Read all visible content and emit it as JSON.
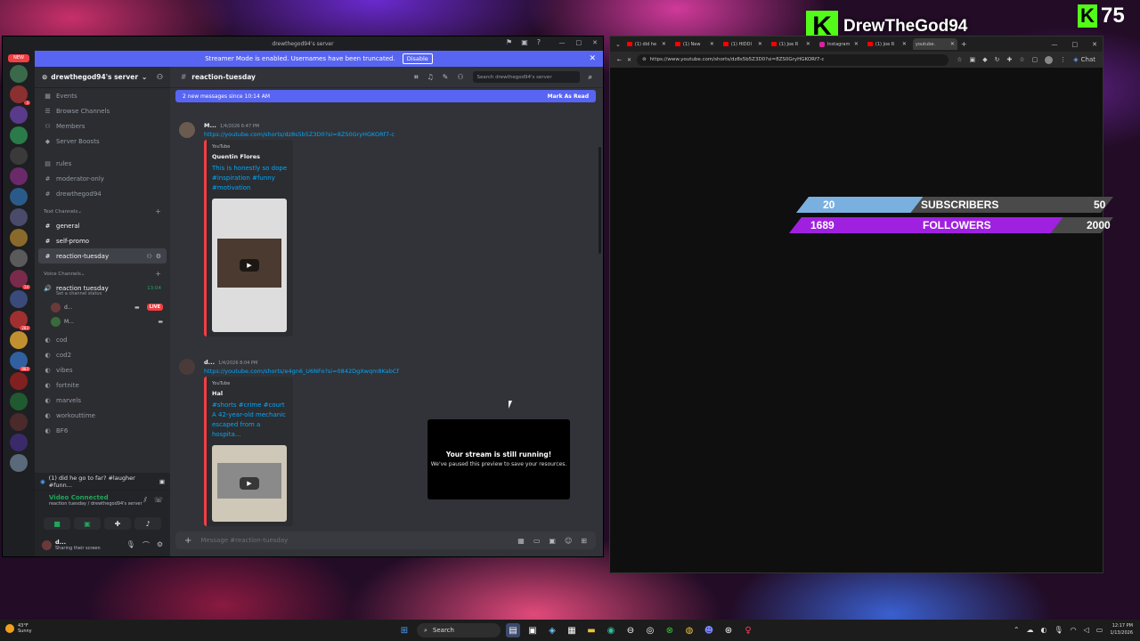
{
  "discord": {
    "window_title": "drewthegod94's server",
    "banner": {
      "text": "Streamer Mode is enabled. Usernames have been truncated.",
      "button": "Disable"
    },
    "new_badge": "NEW",
    "server_name": "drewthegod94's server",
    "top_items": [
      "Events",
      "Browse Channels",
      "Members",
      "Server Boosts"
    ],
    "info_channels": [
      "rules",
      "moderator-only",
      "drewthegod94"
    ],
    "text_category": "Text Channels",
    "text_channels": [
      "general",
      "self-promo",
      "reaction-tuesday"
    ],
    "voice_category": "Voice Channels",
    "voice_channel": {
      "name": "reaction tuesday",
      "time": "13:04",
      "status": "Set a channel status"
    },
    "voice_users": [
      {
        "name": "d...",
        "badge": "LIVE"
      },
      {
        "name": "M..."
      }
    ],
    "voice_channels_more": [
      "cod",
      "cod2",
      "vibes",
      "fortnite",
      "marvels",
      "workouttime",
      "BF6"
    ],
    "now_playing": "(1) did he go to far? #laugher #funn...",
    "voice_connected": {
      "title": "Video Connected",
      "sub": "reaction tuesday / drewthegod94's server"
    },
    "me": {
      "name": "d...",
      "status": "Sharing their screen"
    },
    "channel_header": "reaction-tuesday",
    "search_placeholder": "Search drewthegod94's server",
    "new_messages": {
      "text": "2 new messages since 10:14 AM",
      "action": "Mark As Read"
    },
    "messages": [
      {
        "author": "M...",
        "time": "1/4/2026 6:47 PM",
        "link": "https://youtube.com/shorts/dz8s5b5Z3D0?si=8ZS0GryHGKORf7-c",
        "provider": "YouTube",
        "embed_author": "Quentin Flores",
        "embed_title": "This is honestly so dope #inspiration #funny #motivation"
      },
      {
        "author": "d...",
        "time": "1/4/2026 8:04 PM",
        "link": "https://youtube.com/shorts/e4gn6_U6NFo?si=0842DgXwqm8KabCf",
        "provider": "YouTube",
        "embed_author": "Hal",
        "embed_title": "#shorts #crime #court A 42-year-old mechanic escaped from a hospita..."
      }
    ],
    "message_placeholder": "Message #reaction-tuesday",
    "paused": {
      "title": "Your stream is still running!",
      "sub": "We've paused this preview to save your resources."
    }
  },
  "browser": {
    "tabs": [
      {
        "label": "(1) did he",
        "kind": "yt"
      },
      {
        "label": "(1) New",
        "kind": "yt"
      },
      {
        "label": "(1) HIDDI",
        "kind": "yt"
      },
      {
        "label": "(1) Joe R",
        "kind": "yt"
      },
      {
        "label": "Instagram",
        "kind": "ig"
      },
      {
        "label": "(1) Joe R",
        "kind": "yt"
      },
      {
        "label": "youtube.",
        "kind": "yt"
      }
    ],
    "url": "https://www.youtube.com/shorts/dz8s5b5Z3D0?si=8ZS0GryHGKORf7-c",
    "chat_label": "Chat"
  },
  "overlay": {
    "kick_name": "DrewTheGod94",
    "viewer_count": "75",
    "subs": {
      "current": "20",
      "label": "SUBSCRIBERS",
      "goal": "50",
      "fraction": 0.4
    },
    "followers": {
      "current": "1689",
      "label": "FOLLOWERS",
      "goal": "2000",
      "fraction": 0.845
    }
  },
  "taskbar": {
    "weather_temp": "43°F",
    "weather_desc": "Sunny",
    "search": "Search",
    "time": "12:17 PM",
    "date": "1/13/2026"
  },
  "colors": {
    "discord_bg": "#313338",
    "blurple": "#5865f2",
    "kick_green": "#53fc18",
    "subs_fill": "#7ab0e0",
    "followers_fill": "#a020e0"
  }
}
